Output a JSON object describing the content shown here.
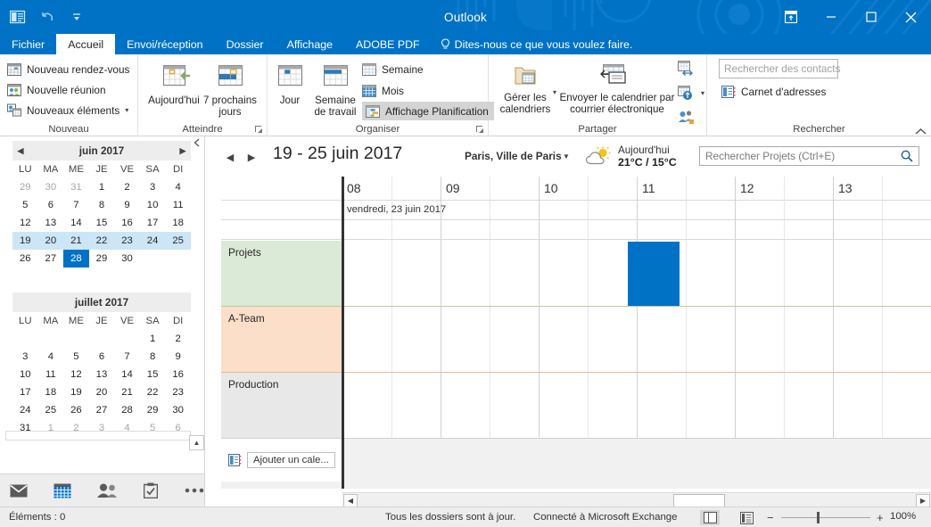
{
  "titlebar": {
    "title": "Outlook",
    "quick_access": [
      "outlook-logo-icon",
      "undo-icon",
      "customize-qat-icon"
    ],
    "window_buttons": [
      "ribbon-display-options",
      "minimize",
      "maximize",
      "close"
    ],
    "accent_color": "#0072C6"
  },
  "tabs": [
    {
      "label": "Fichier",
      "active": false
    },
    {
      "label": "Accueil",
      "active": true
    },
    {
      "label": "Envoi/réception",
      "active": false
    },
    {
      "label": "Dossier",
      "active": false
    },
    {
      "label": "Affichage",
      "active": false
    },
    {
      "label": "ADOBE PDF",
      "active": false
    }
  ],
  "tellme": {
    "label": "Dites-nous ce que vous voulez faire."
  },
  "ribbon": {
    "groups": [
      {
        "name": "Nouveau",
        "items": [
          {
            "label": "Nouveau rendez-vous",
            "icon": "new-appointment-icon"
          },
          {
            "label": "Nouvelle réunion",
            "icon": "new-meeting-icon"
          },
          {
            "label": "Nouveaux éléments",
            "icon": "new-items-icon",
            "dropdown": true
          }
        ]
      },
      {
        "name": "Atteindre",
        "has_dialog_launcher": true,
        "items": [
          {
            "label": "Aujourd'hui",
            "icon": "today-icon"
          },
          {
            "label": "7 prochains jours",
            "icon": "next-7-days-icon"
          }
        ]
      },
      {
        "name": "Organiser",
        "has_dialog_launcher": true,
        "items": [
          {
            "label": "Jour",
            "icon": "day-view-icon"
          },
          {
            "label": "Semaine de travail",
            "icon": "work-week-view-icon"
          },
          {
            "label": "Semaine",
            "icon": "week-view-icon"
          },
          {
            "label": "Mois",
            "icon": "month-view-icon"
          },
          {
            "label": "Affichage Planification",
            "icon": "schedule-view-icon",
            "selected": true
          }
        ]
      },
      {
        "name": "Partager",
        "items": [
          {
            "label": "Gérer les calendriers",
            "icon": "manage-calendars-icon",
            "dropdown": true
          },
          {
            "label": "Envoyer le calendrier par courrier électronique",
            "icon": "email-calendar-icon"
          },
          {
            "label": "",
            "icon": "share-calendar-icon"
          },
          {
            "label": "",
            "icon": "publish-online-icon",
            "dropdown": true
          },
          {
            "label": "",
            "icon": "calendar-permissions-icon"
          }
        ]
      },
      {
        "name": "Rechercher",
        "items": [
          {
            "label": "",
            "placeholder": "Rechercher des contacts",
            "type": "input"
          },
          {
            "label": "Carnet d'adresses",
            "icon": "address-book-icon"
          }
        ]
      }
    ],
    "collapse_label": "collapse-ribbon-icon"
  },
  "minicalendars": [
    {
      "title": "juin 2017",
      "prev": "◀",
      "next": "▶",
      "dow": [
        "LU",
        "MA",
        "ME",
        "JE",
        "VE",
        "SA",
        "DI"
      ],
      "weeks": [
        {
          "selected": false,
          "days": [
            {
              "n": "29",
              "other": true
            },
            {
              "n": "30",
              "other": true
            },
            {
              "n": "31",
              "other": true
            },
            {
              "n": "1"
            },
            {
              "n": "2"
            },
            {
              "n": "3"
            },
            {
              "n": "4"
            }
          ]
        },
        {
          "selected": false,
          "days": [
            {
              "n": "5"
            },
            {
              "n": "6"
            },
            {
              "n": "7"
            },
            {
              "n": "8"
            },
            {
              "n": "9"
            },
            {
              "n": "10"
            },
            {
              "n": "11"
            }
          ]
        },
        {
          "selected": false,
          "days": [
            {
              "n": "12"
            },
            {
              "n": "13"
            },
            {
              "n": "14"
            },
            {
              "n": "15"
            },
            {
              "n": "16"
            },
            {
              "n": "17"
            },
            {
              "n": "18"
            }
          ]
        },
        {
          "selected": true,
          "days": [
            {
              "n": "19"
            },
            {
              "n": "20"
            },
            {
              "n": "21"
            },
            {
              "n": "22"
            },
            {
              "n": "23"
            },
            {
              "n": "24"
            },
            {
              "n": "25"
            }
          ]
        },
        {
          "selected": false,
          "days": [
            {
              "n": "26"
            },
            {
              "n": "27"
            },
            {
              "n": "28",
              "today": true
            },
            {
              "n": "29"
            },
            {
              "n": "30"
            },
            {
              "n": ""
            },
            {
              "n": ""
            }
          ]
        }
      ]
    },
    {
      "title": "juillet 2017",
      "dow": [
        "LU",
        "MA",
        "ME",
        "JE",
        "VE",
        "SA",
        "DI"
      ],
      "weeks": [
        {
          "selected": false,
          "days": [
            {
              "n": ""
            },
            {
              "n": ""
            },
            {
              "n": ""
            },
            {
              "n": ""
            },
            {
              "n": ""
            },
            {
              "n": "1"
            },
            {
              "n": "2"
            }
          ]
        },
        {
          "selected": false,
          "days": [
            {
              "n": "3"
            },
            {
              "n": "4"
            },
            {
              "n": "5"
            },
            {
              "n": "6"
            },
            {
              "n": "7"
            },
            {
              "n": "8"
            },
            {
              "n": "9"
            }
          ]
        },
        {
          "selected": false,
          "days": [
            {
              "n": "10"
            },
            {
              "n": "11"
            },
            {
              "n": "12"
            },
            {
              "n": "13"
            },
            {
              "n": "14"
            },
            {
              "n": "15"
            },
            {
              "n": "16"
            }
          ]
        },
        {
          "selected": false,
          "days": [
            {
              "n": "17"
            },
            {
              "n": "18"
            },
            {
              "n": "19"
            },
            {
              "n": "20"
            },
            {
              "n": "21"
            },
            {
              "n": "22"
            },
            {
              "n": "23"
            }
          ]
        },
        {
          "selected": false,
          "days": [
            {
              "n": "24"
            },
            {
              "n": "25"
            },
            {
              "n": "26"
            },
            {
              "n": "27"
            },
            {
              "n": "28"
            },
            {
              "n": "29"
            },
            {
              "n": "30"
            }
          ]
        },
        {
          "selected": false,
          "days": [
            {
              "n": "31"
            },
            {
              "n": "1",
              "other": true
            },
            {
              "n": "2",
              "other": true
            },
            {
              "n": "3",
              "other": true
            },
            {
              "n": "4",
              "other": true
            },
            {
              "n": "5",
              "other": true
            },
            {
              "n": "6",
              "other": true
            }
          ]
        }
      ]
    }
  ],
  "navbar": {
    "items": [
      {
        "icon": "mail-icon",
        "name": "nav-mail",
        "active": false
      },
      {
        "icon": "calendar-icon",
        "name": "nav-calendar",
        "active": true
      },
      {
        "icon": "people-icon",
        "name": "nav-people",
        "active": false
      },
      {
        "icon": "tasks-icon",
        "name": "nav-tasks",
        "active": false
      },
      {
        "icon": "more-icon",
        "name": "nav-more",
        "active": false
      }
    ]
  },
  "calendar_header": {
    "prev": "◀",
    "next": "▶",
    "date_range": "19 - 25 juin 2017",
    "location": "Paris, Ville de Paris",
    "weather_today_label": "Aujourd'hui",
    "weather_temps": "21°C / 15°C",
    "weather_icon": "partly-cloudy-icon",
    "search_placeholder": "Rechercher Projets (Ctrl+E)",
    "search_value": ""
  },
  "schedule": {
    "time_headers": [
      "08",
      "09",
      "10",
      "11",
      "12",
      "13"
    ],
    "day_label": "vendredi, 23 juin 2017",
    "calendars": [
      {
        "name": "Projets",
        "color": "#dbead7",
        "border": "#bcca9f",
        "appointments": [
          {
            "start_pct": 48.5,
            "width_pct": 8.8,
            "color": "#0072C6",
            "title": ""
          }
        ]
      },
      {
        "name": "A-Team",
        "color": "#fbdfc9",
        "border": "#e2bb9b",
        "appointments": []
      },
      {
        "name": "Production",
        "color": "#e8e8e8",
        "border": "#d0d0d0",
        "appointments": []
      }
    ],
    "add_calendar_label": "Ajouter un cale...",
    "add_calendar_icon": "add-calendar-icon"
  },
  "scrollbar": {
    "left_arrow": "◀",
    "right_arrow": "▶"
  },
  "statusbar": {
    "items_count": "Éléments : 0",
    "sync_status": "Tous les dossiers sont à jour.",
    "connection": "Connecté à Microsoft Exchange",
    "view_normal_icon": "normal-view-icon",
    "view_reading_icon": "reading-view-icon",
    "zoom_minus": "−",
    "zoom_plus": "+",
    "zoom_level": "100%"
  }
}
